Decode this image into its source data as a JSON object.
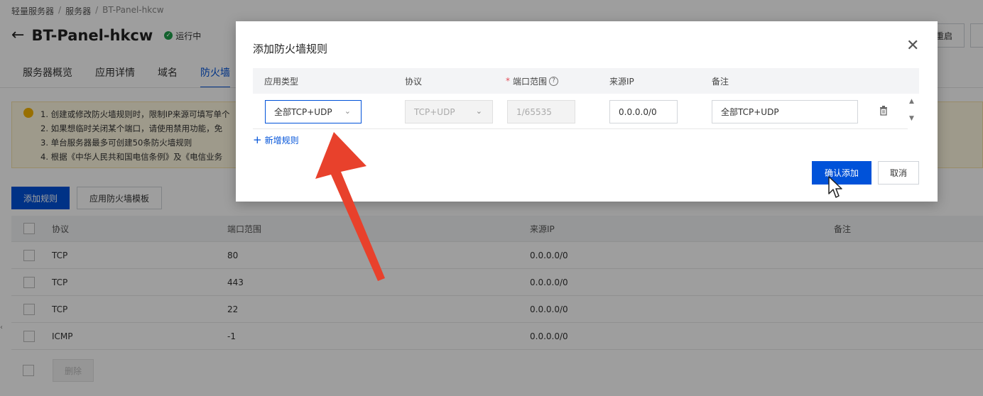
{
  "breadcrumb": {
    "items": [
      "轻量服务器",
      "服务器",
      "BT-Panel-hkcw"
    ],
    "separator": "/"
  },
  "header": {
    "title": "BT-Panel-hkcw",
    "status": "运行中",
    "restart_label": "重启"
  },
  "tabs": [
    {
      "label": "服务器概览"
    },
    {
      "label": "应用详情"
    },
    {
      "label": "域名"
    },
    {
      "label": "防火墙"
    }
  ],
  "notice": {
    "lines": [
      "1. 创建或修改防火墙规则时，限制IP来源可填写单个",
      "2. 如果想临时关闭某个端口，请使用禁用功能，免",
      "3. 单台服务器最多可创建50条防火墙规则",
      "4. 根据《中华人民共和国电信条例》及《电信业务"
    ]
  },
  "actions": {
    "add_rule_label": "添加规则",
    "apply_template_label": "应用防火墙模板",
    "delete_label": "删除"
  },
  "table": {
    "headers": {
      "protocol": "协议",
      "port": "端口范围",
      "source": "来源IP",
      "note": "备注"
    },
    "rows": [
      {
        "protocol": "TCP",
        "port": "80",
        "source": "0.0.0.0/0"
      },
      {
        "protocol": "TCP",
        "port": "443",
        "source": "0.0.0.0/0"
      },
      {
        "protocol": "TCP",
        "port": "22",
        "source": "0.0.0.0/0"
      },
      {
        "protocol": "ICMP",
        "port": "-1",
        "source": "0.0.0.0/0"
      }
    ]
  },
  "modal": {
    "title": "添加防火墙规则",
    "headers": {
      "app_type": "应用类型",
      "protocol": "协议",
      "port_range": "端口范围",
      "source_ip": "来源IP",
      "note": "备注"
    },
    "row": {
      "app_type": "全部TCP+UDP",
      "protocol": "TCP+UDP",
      "port_range": "1/65535",
      "source_ip": "0.0.0.0/0",
      "note": "全部TCP+UDP"
    },
    "add_rule_link": "新增规则",
    "confirm_label": "确认添加",
    "cancel_label": "取消"
  },
  "icons": {
    "back": "arrow-left-icon",
    "status": "check-circle-icon",
    "close": "close-icon",
    "help": "question-circle-icon",
    "trash": "trash-icon",
    "chevron": "chevron-down-icon",
    "plus": "plus-icon",
    "cursor": "mouse-pointer-icon",
    "annotation": "red-arrow-icon"
  },
  "colors": {
    "primary": "#0052d9",
    "status_green": "#1e9e4a",
    "annotation_red": "#e8412c",
    "notice_bg": "#fff8e0"
  }
}
